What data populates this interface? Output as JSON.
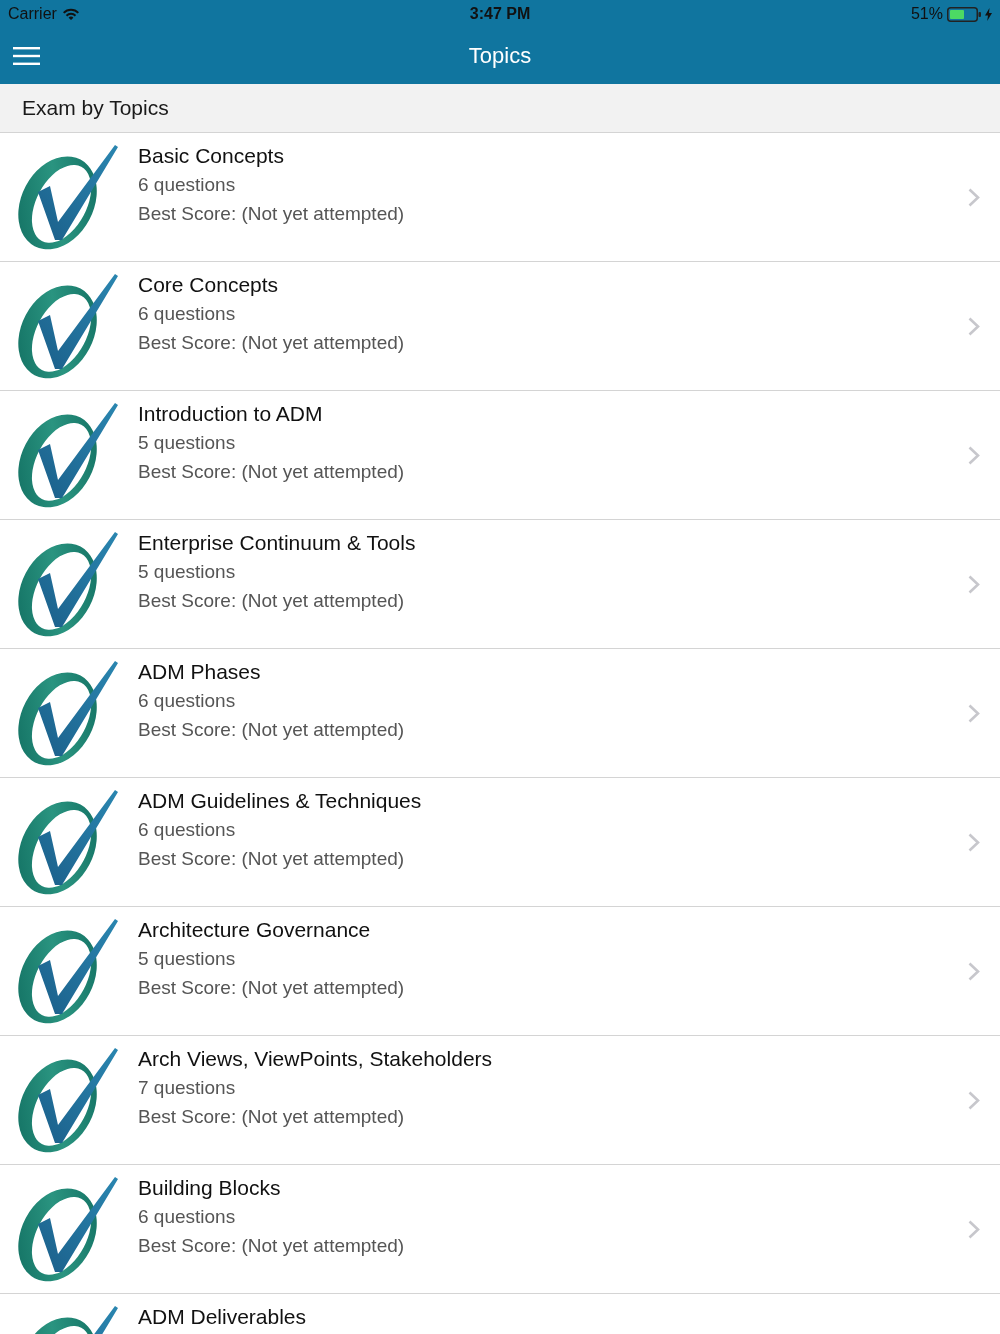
{
  "status_bar": {
    "carrier": "Carrier",
    "time": "3:47 PM",
    "battery": "51%",
    "charging": true
  },
  "nav_bar": {
    "title": "Topics"
  },
  "section": {
    "title": "Exam by Topics"
  },
  "topics": [
    {
      "title": "Basic Concepts",
      "questions": "6 questions",
      "best_score": "Best Score: (Not yet attempted)"
    },
    {
      "title": "Core Concepts",
      "questions": "6 questions",
      "best_score": "Best Score: (Not yet attempted)"
    },
    {
      "title": "Introduction to ADM",
      "questions": "5 questions",
      "best_score": "Best Score: (Not yet attempted)"
    },
    {
      "title": "Enterprise Continuum & Tools",
      "questions": "5 questions",
      "best_score": "Best Score: (Not yet attempted)"
    },
    {
      "title": "ADM Phases",
      "questions": "6 questions",
      "best_score": "Best Score: (Not yet attempted)"
    },
    {
      "title": "ADM Guidelines & Techniques",
      "questions": "6 questions",
      "best_score": "Best Score: (Not yet attempted)"
    },
    {
      "title": "Architecture Governance",
      "questions": "5 questions",
      "best_score": "Best Score: (Not yet attempted)"
    },
    {
      "title": "Arch Views, ViewPoints, Stakeholders",
      "questions": "7 questions",
      "best_score": "Best Score: (Not yet attempted)"
    },
    {
      "title": "Building Blocks",
      "questions": "6 questions",
      "best_score": "Best Score: (Not yet attempted)"
    },
    {
      "title": "ADM Deliverables"
    }
  ]
}
